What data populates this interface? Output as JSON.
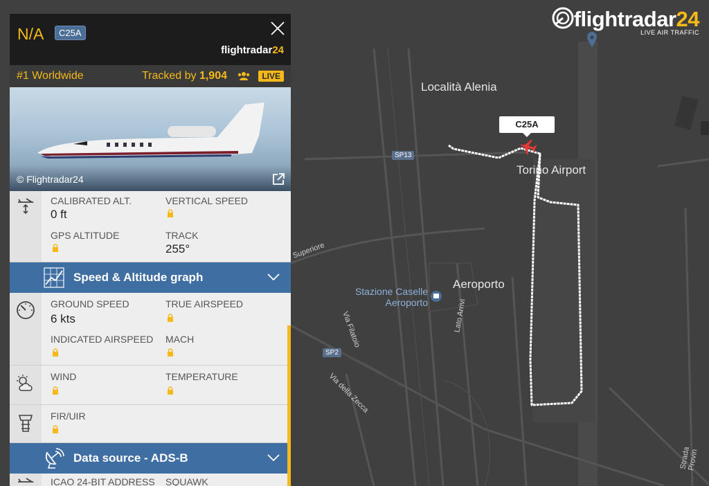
{
  "brand": {
    "word": "flightradar",
    "num": "24",
    "tagline": "LIVE AIR TRAFFIC"
  },
  "map": {
    "places": {
      "alenia": "Località Alenia",
      "airport": "Torino Airport",
      "aeroporto": "Aeroporto",
      "station": "Stazione Caselle Aeroporto"
    },
    "roads": {
      "sp13": "SP13",
      "sp2": "SP2",
      "superiore": "Superiore",
      "filatoio": "Via Filatoio",
      "zecca": "Via della Zecca",
      "arrivi": "Lato Arrivi",
      "provin": "Strada Provin"
    },
    "aircraft_callsign": "C25A"
  },
  "panel": {
    "registration": "N/A",
    "aircraft_type": "C25A",
    "header_logo": {
      "word": "flightradar",
      "num": "24"
    },
    "rank": "#1 Worldwide",
    "tracked_prefix": "Tracked by ",
    "tracked_count": "1,904",
    "live_badge": "LIVE",
    "photo_credit": "© Flightradar24",
    "altitude": {
      "calibrated_alt_label": "CALIBRATED ALT.",
      "calibrated_alt_value": "0 ft",
      "vertical_speed_label": "VERTICAL SPEED",
      "gps_altitude_label": "GPS ALTITUDE",
      "track_label": "TRACK",
      "track_value": "255°"
    },
    "graph_bar": "Speed & Altitude graph",
    "speed": {
      "ground_speed_label": "GROUND SPEED",
      "ground_speed_value": "6 kts",
      "true_airspeed_label": "TRUE AIRSPEED",
      "indicated_airspeed_label": "INDICATED AIRSPEED",
      "mach_label": "MACH"
    },
    "weather": {
      "wind_label": "WIND",
      "temperature_label": "TEMPERATURE"
    },
    "fir": {
      "fir_label": "FIR/UIR"
    },
    "source_bar": "Data source - ADS-B",
    "icao": {
      "icao_label": "ICAO 24-BIT ADDRESS",
      "squawk_label": "SQUAWK"
    }
  },
  "colors": {
    "accent": "#f5b919",
    "bar": "#3f6ea2",
    "map": "#3f3f3f"
  }
}
